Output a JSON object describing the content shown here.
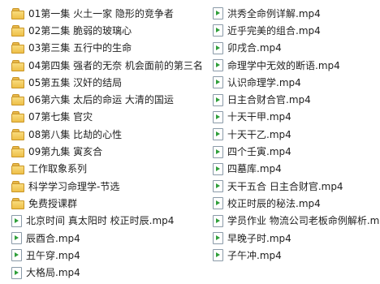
{
  "left_column": [
    {
      "name": "01第一集 火土一家 隐形的竞争者",
      "icon": "folder-icon"
    },
    {
      "name": "02第二集 脆弱的玻璃心",
      "icon": "folder-icon"
    },
    {
      "name": "03第三集 五行中的生命",
      "icon": "folder-icon"
    },
    {
      "name": "04第四集 强者的无奈 机会面前的第三名",
      "icon": "folder-icon"
    },
    {
      "name": "05第五集 汉奸的结局",
      "icon": "folder-icon"
    },
    {
      "name": "06第六集 太后的命运 大清的国运",
      "icon": "folder-icon"
    },
    {
      "name": "07第七集 官灾",
      "icon": "folder-icon"
    },
    {
      "name": "08第八集 比劫的心性",
      "icon": "folder-icon"
    },
    {
      "name": "09第九集 寅亥合",
      "icon": "folder-icon"
    },
    {
      "name": "工作取象系列",
      "icon": "folder-icon"
    },
    {
      "name": "科学学习命理学-节选",
      "icon": "folder-icon"
    },
    {
      "name": "免费授课群",
      "icon": "folder-icon"
    },
    {
      "name": "北京时间 真太阳时 校正时辰.mp4",
      "icon": "video-file-icon"
    },
    {
      "name": "辰酉合.mp4",
      "icon": "video-file-icon"
    },
    {
      "name": "丑午穿.mp4",
      "icon": "video-file-icon"
    },
    {
      "name": "大格局.mp4",
      "icon": "video-file-icon"
    }
  ],
  "right_column": [
    {
      "name": "洪秀全命例详解.mp4",
      "icon": "video-file-icon"
    },
    {
      "name": "近乎完美的组合.mp4",
      "icon": "video-file-icon"
    },
    {
      "name": "卯戌合.mp4",
      "icon": "video-file-icon"
    },
    {
      "name": "命理学中无效的断语.mp4",
      "icon": "video-file-icon"
    },
    {
      "name": "认识命理学.mp4",
      "icon": "video-file-icon"
    },
    {
      "name": "日主合财合官.mp4",
      "icon": "video-file-icon"
    },
    {
      "name": "十天干甲.mp4",
      "icon": "video-file-icon"
    },
    {
      "name": "十天干乙.mp4",
      "icon": "video-file-icon"
    },
    {
      "name": "四个壬寅.mp4",
      "icon": "video-file-icon"
    },
    {
      "name": "四墓库.mp4",
      "icon": "video-file-icon"
    },
    {
      "name": "天干五合 日主合财官.mp4",
      "icon": "video-file-icon"
    },
    {
      "name": "校正时辰的秘法.mp4",
      "icon": "video-file-icon"
    },
    {
      "name": "学员作业 物流公司老板命例解析.mp4",
      "icon": "video-file-icon"
    },
    {
      "name": "早晚子时.mp4",
      "icon": "video-file-icon"
    },
    {
      "name": "子午冲.mp4",
      "icon": "video-file-icon"
    }
  ]
}
